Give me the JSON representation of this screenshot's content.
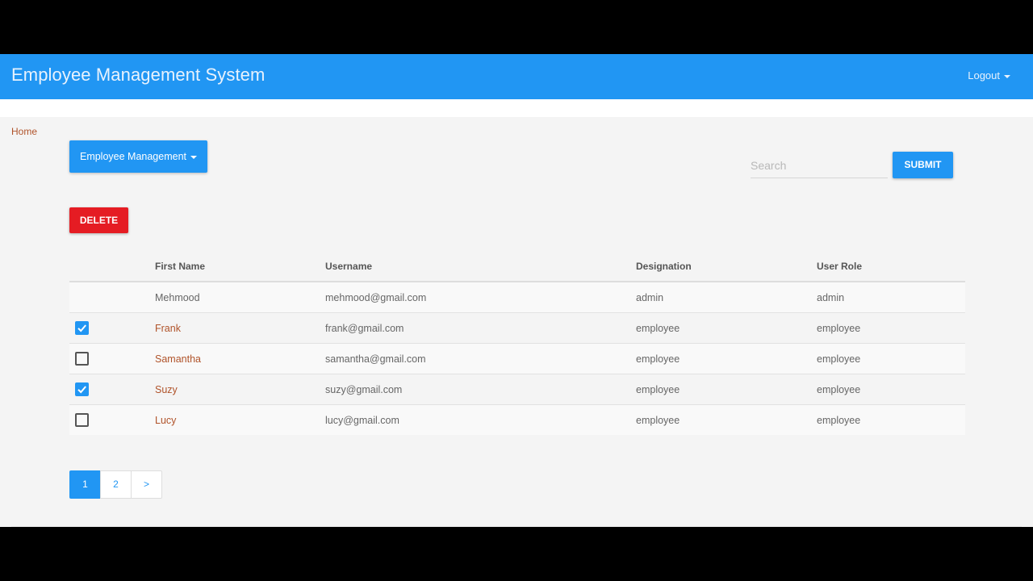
{
  "app": {
    "title": "Employee Management System",
    "logout_label": "Logout"
  },
  "breadcrumb": {
    "home_label": "Home"
  },
  "toolbar": {
    "dropdown_label": "Employee Management",
    "search_placeholder": "Search",
    "search_value": "",
    "submit_label": "SUBMIT",
    "delete_label": "DELETE"
  },
  "table": {
    "headers": [
      "",
      "First Name",
      "Username",
      "Designation",
      "User Role"
    ],
    "rows": [
      {
        "has_checkbox": false,
        "checked": false,
        "first_name": "Mehmood",
        "username": "mehmood@gmail.com",
        "designation": "admin",
        "user_role": "admin"
      },
      {
        "has_checkbox": true,
        "checked": true,
        "first_name": "Frank",
        "username": "frank@gmail.com",
        "designation": "employee",
        "user_role": "employee"
      },
      {
        "has_checkbox": true,
        "checked": false,
        "first_name": "Samantha",
        "username": "samantha@gmail.com",
        "designation": "employee",
        "user_role": "employee"
      },
      {
        "has_checkbox": true,
        "checked": true,
        "first_name": "Suzy",
        "username": "suzy@gmail.com",
        "designation": "employee",
        "user_role": "employee"
      },
      {
        "has_checkbox": true,
        "checked": false,
        "first_name": "Lucy",
        "username": "lucy@gmail.com",
        "designation": "employee",
        "user_role": "employee"
      }
    ]
  },
  "pagination": {
    "pages": [
      "1",
      "2"
    ],
    "next_label": ">",
    "current": "1"
  },
  "colors": {
    "primary": "#2196f3",
    "danger": "#e51c23",
    "link": "#b0532a"
  }
}
